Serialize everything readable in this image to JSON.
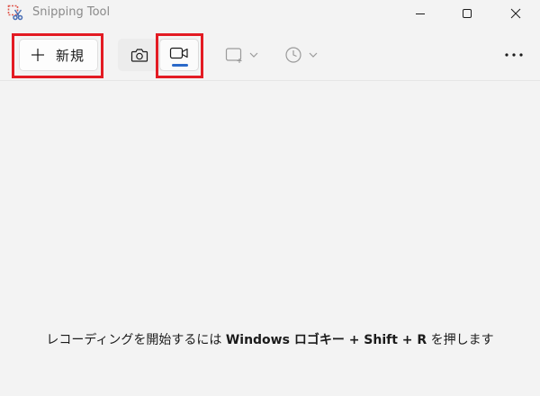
{
  "window": {
    "title": "Snipping Tool"
  },
  "toolbar": {
    "new_label": "新規",
    "new_icon": "plus-icon",
    "modes": [
      {
        "name": "screenshot",
        "icon": "camera-icon",
        "selected": false
      },
      {
        "name": "video",
        "icon": "video-camera-icon",
        "selected": true
      }
    ],
    "shape_icon": "rectangle-snip-icon",
    "delay_icon": "clock-icon",
    "more_icon": "more-icon"
  },
  "colors": {
    "highlight": "#e31b23",
    "accent": "#2a69c9"
  },
  "main": {
    "hint_pre": "レコーディングを開始するには ",
    "hint_key": "Windows ロゴキー + Shift + R",
    "hint_post": " を押します"
  }
}
